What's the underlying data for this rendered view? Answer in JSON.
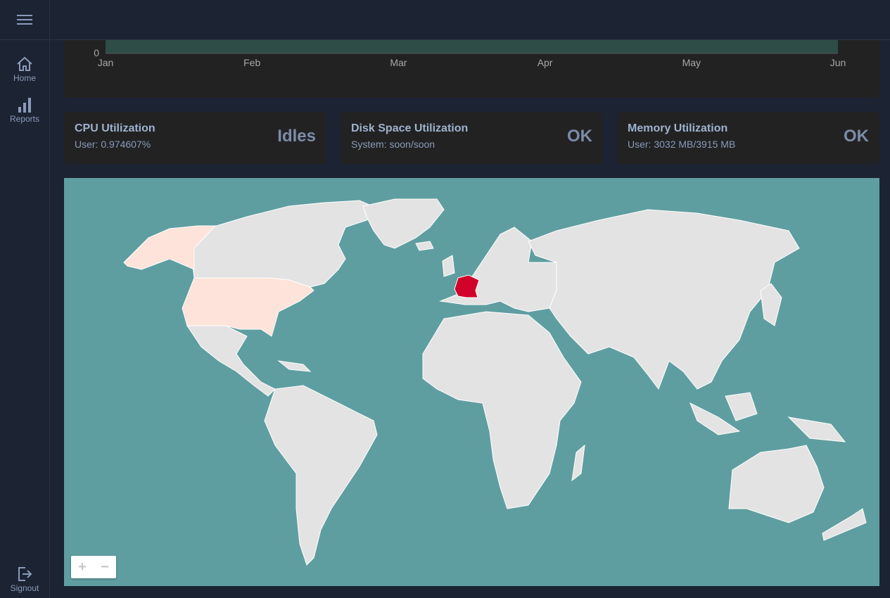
{
  "sidebar": {
    "items": [
      {
        "label": "Home",
        "icon": "home-icon"
      },
      {
        "label": "Reports",
        "icon": "bar-chart-icon"
      }
    ],
    "signout": {
      "label": "Signout",
      "icon": "signout-icon"
    }
  },
  "chart_data": {
    "type": "area",
    "x": [
      "Jan",
      "Feb",
      "Mar",
      "Apr",
      "May",
      "Jun"
    ],
    "y_tick_visible": "0",
    "series_color": "#2e4d47"
  },
  "cards": [
    {
      "title": "CPU Utilization",
      "sub": "User: 0.974607%",
      "value": "Idles"
    },
    {
      "title": "Disk Space Utilization",
      "sub": "System: soon/soon",
      "value": "OK"
    },
    {
      "title": "Memory Utilization",
      "sub": "User: 3032 MB/3915 MB",
      "value": "OK"
    }
  ],
  "map": {
    "ocean_color": "#5f9ea0",
    "land_color": "#e3e3e3",
    "highlight_strong": "#d0022a",
    "highlight_light": "#fde3da",
    "highlighted": [
      "France",
      "United States",
      "Alaska"
    ],
    "zoom_in": "+",
    "zoom_out": "−"
  }
}
